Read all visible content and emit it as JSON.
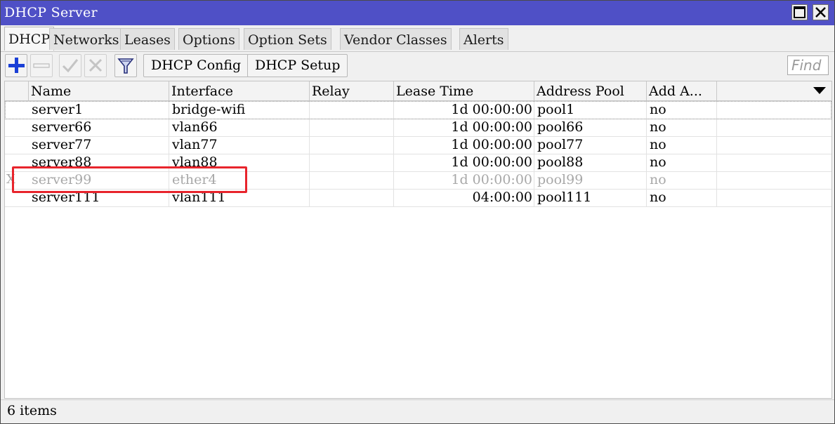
{
  "window": {
    "title": "DHCP Server"
  },
  "title_buttons": {
    "maximize_icon": "maximize-icon",
    "close_icon": "close-icon"
  },
  "tabs": [
    {
      "label": "DHCP",
      "active": true
    },
    {
      "label": "Networks"
    },
    {
      "label": "Leases"
    },
    {
      "label": "Options"
    },
    {
      "label": "Option Sets"
    },
    {
      "label": "Vendor Classes"
    },
    {
      "label": "Alerts"
    }
  ],
  "toolbar": {
    "add_icon": "plus-icon",
    "remove_icon": "minus-icon",
    "enable_icon": "check-icon",
    "disable_icon": "cross-icon",
    "filter_icon": "filter-icon",
    "dhcp_config_label": "DHCP Config",
    "dhcp_setup_label": "DHCP Setup",
    "find_placeholder": "Find"
  },
  "table": {
    "columns": [
      "Name",
      "Interface",
      "Relay",
      "Lease Time",
      "Address Pool",
      "Add A..."
    ],
    "sort_column": "Name",
    "rows": [
      {
        "flag": "",
        "name": "server1",
        "interface": "bridge-wifi",
        "relay": "",
        "lease_time": "1d 00:00:00",
        "address_pool": "pool1",
        "add_arp": "no",
        "disabled": false
      },
      {
        "flag": "",
        "name": "server66",
        "interface": "vlan66",
        "relay": "",
        "lease_time": "1d 00:00:00",
        "address_pool": "pool66",
        "add_arp": "no",
        "disabled": false
      },
      {
        "flag": "",
        "name": "server77",
        "interface": "vlan77",
        "relay": "",
        "lease_time": "1d 00:00:00",
        "address_pool": "pool77",
        "add_arp": "no",
        "disabled": false
      },
      {
        "flag": "",
        "name": "server88",
        "interface": "vlan88",
        "relay": "",
        "lease_time": "1d 00:00:00",
        "address_pool": "pool88",
        "add_arp": "no",
        "disabled": false
      },
      {
        "flag": "X",
        "name": "server99",
        "interface": "ether4",
        "relay": "",
        "lease_time": "1d 00:00:00",
        "address_pool": "pool99",
        "add_arp": "no",
        "disabled": true
      },
      {
        "flag": "",
        "name": "server111",
        "interface": "vlan111",
        "relay": "",
        "lease_time": "04:00:00",
        "address_pool": "pool111",
        "add_arp": "no",
        "disabled": false
      }
    ]
  },
  "status": {
    "count": "6 items"
  },
  "colors": {
    "titlebar": "#4f50c6",
    "highlight": "#e8242c",
    "add_icon": "#1a3fd6"
  }
}
